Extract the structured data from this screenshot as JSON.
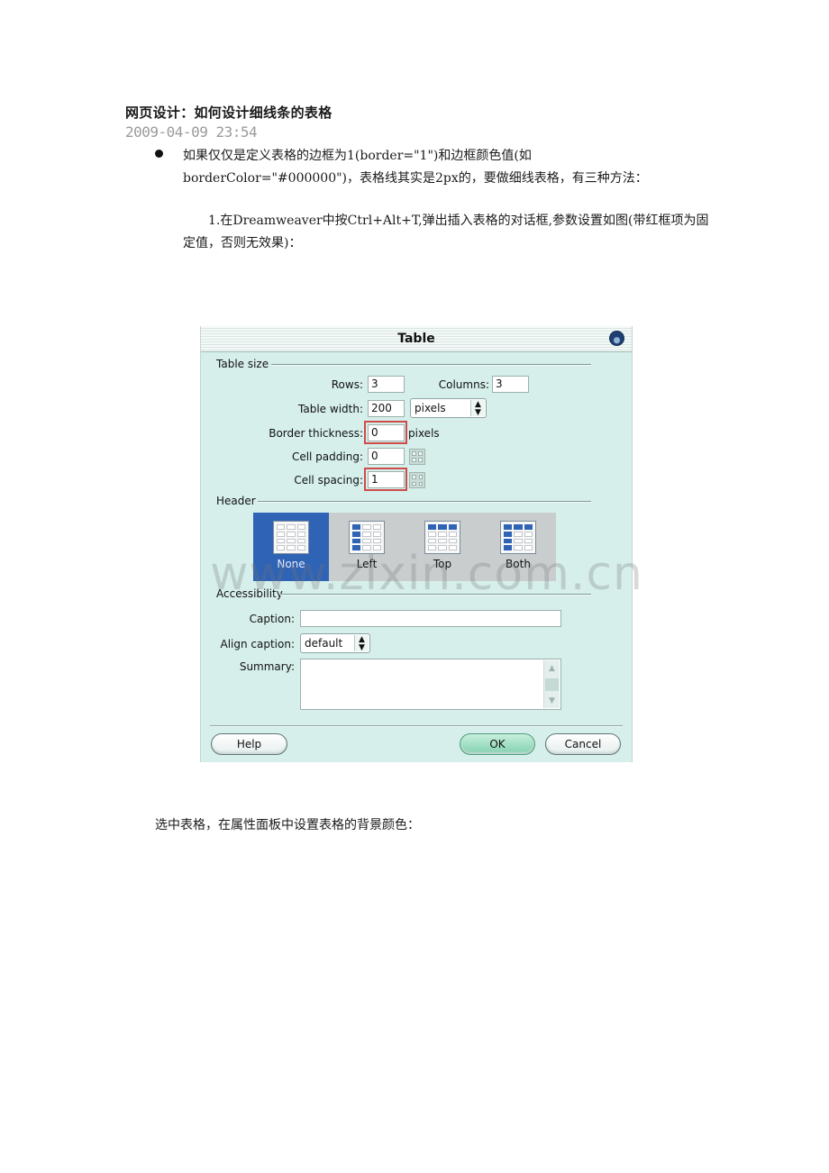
{
  "article": {
    "title": "网页设计：如何设计细线条的表格",
    "date": "2009-04-09 23:54",
    "bullet_text": "如果仅仅是定义表格的边框为1(border=\"1\")和边框颜色值(如borderColor=\"#000000\")，表格线其实是2px的，要做细线表格，有三种方法：",
    "step1_text": "1.在Dreamweaver中按Ctrl+Alt+T,弹出插入表格的对话框,参数设置如图(带红框项为固定值，否则无效果)：",
    "after_image_text": "选中表格，在属性面板中设置表格的背景颜色："
  },
  "dialog": {
    "title": "Table",
    "close_icon": "close-orb-icon",
    "table_size": {
      "section_label": "Table size",
      "rows_label": "Rows:",
      "rows_value": "3",
      "columns_label": "Columns:",
      "columns_value": "3",
      "width_label": "Table width:",
      "width_value": "200",
      "width_unit": "pixels",
      "border_label": "Border thickness:",
      "border_value": "0",
      "border_unit": "pixels",
      "padding_label": "Cell padding:",
      "padding_value": "0",
      "spacing_label": "Cell spacing:",
      "spacing_value": "1"
    },
    "header": {
      "section_label": "Header",
      "options": [
        {
          "label": "None",
          "selected": true
        },
        {
          "label": "Left",
          "selected": false
        },
        {
          "label": "Top",
          "selected": false
        },
        {
          "label": "Both",
          "selected": false
        }
      ]
    },
    "accessibility": {
      "section_label": "Accessibility",
      "caption_label": "Caption:",
      "caption_value": "",
      "align_label": "Align caption:",
      "align_value": "default",
      "summary_label": "Summary:",
      "summary_value": ""
    },
    "buttons": {
      "help": "Help",
      "ok": "OK",
      "cancel": "Cancel"
    },
    "highlight_color": "#d04b4b",
    "accent_color": "#2f63b5"
  },
  "watermark": "www.zixin.com.cn"
}
